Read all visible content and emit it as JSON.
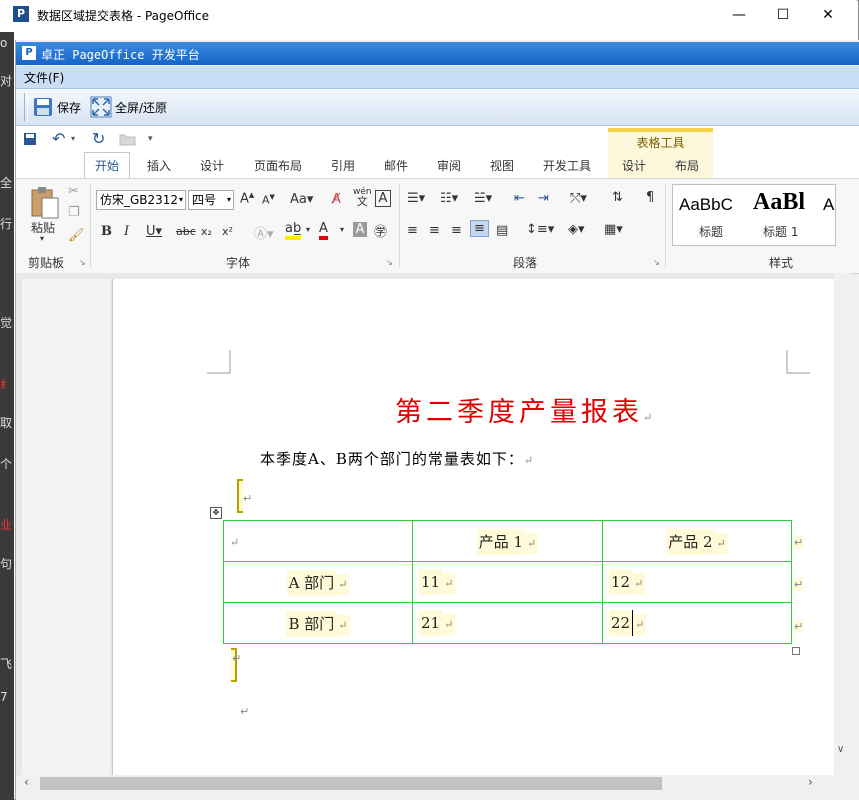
{
  "window": {
    "title": "数据区域提交表格 - PageOffice",
    "app_icon": "P",
    "minimize": "—",
    "maximize": "☐",
    "close": "✕"
  },
  "pageoffice": {
    "title": "卓正 PageOffice 开发平台",
    "icon": "P"
  },
  "menu": {
    "file": "文件(F)"
  },
  "toolbar": {
    "save": "保存",
    "fullscreen": "全屏/还原"
  },
  "ribbon": {
    "tabs": [
      "开始",
      "插入",
      "设计",
      "页面布局",
      "引用",
      "邮件",
      "审阅",
      "视图",
      "开发工具"
    ],
    "context_label": "表格工具",
    "context_tabs": [
      "设计",
      "布局"
    ],
    "clipboard": {
      "paste": "粘贴",
      "group": "剪贴板"
    },
    "font": {
      "name": "仿宋_GB2312",
      "size": "四号",
      "group": "字体",
      "wen_top": "wén",
      "wen_bottom": "文"
    },
    "paragraph": {
      "group": "段落"
    },
    "styles": {
      "group": "样式",
      "items": [
        {
          "preview": "AaBbC",
          "label": "标题"
        },
        {
          "preview": "AaBl",
          "label": "标题 1"
        },
        {
          "preview": "A",
          "label": ""
        }
      ]
    }
  },
  "document": {
    "title": "第二季度产量报表",
    "paragraph": "本季度A、B两个部门的常量表如下：",
    "table": {
      "headers": [
        "",
        "产品 1",
        "产品 2"
      ],
      "rows": [
        {
          "dept": "A 部门",
          "p1": "11",
          "p2": "12"
        },
        {
          "dept": "B 部门",
          "p1": "21",
          "p2": "22"
        }
      ]
    },
    "return_mark": "↵"
  },
  "background_chars": [
    "o",
    "对",
    "全",
    "行",
    "觉",
    "纟",
    "取",
    "个",
    "业",
    "句",
    "飞",
    "7"
  ],
  "colors": {
    "title_red": "#e00000",
    "table_border": "#33cc33",
    "pageoffice_blue": "#1565c7",
    "field_highlight": "#fffbd8"
  }
}
